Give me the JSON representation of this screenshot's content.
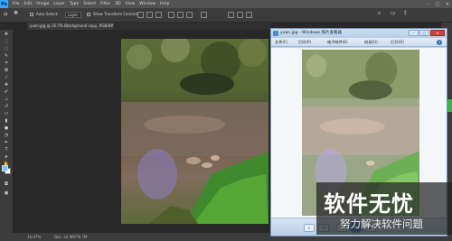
{
  "photoshop": {
    "menus": [
      "File",
      "Edit",
      "Image",
      "Layer",
      "Type",
      "Select",
      "Filter",
      "3D",
      "View",
      "Window",
      "Help"
    ],
    "options": {
      "auto_select_label": "Auto-Select:",
      "auto_select_value": "Layer",
      "transform_controls_label": "Show Transform Controls"
    },
    "document_tab": "yuan.jpg @ 16.7% (Background copy, RGB/8#) *",
    "status": {
      "zoom": "16.67%",
      "doc_size": "Doc: 24.9M/76.7M"
    },
    "colors": {
      "foreground": "#6fc6ff",
      "background": "#ffffff",
      "accent": "#31a8ff"
    }
  },
  "viewer": {
    "title": "yuan.jpg - Windows 照片查看器",
    "menu": [
      "文件(F)",
      "打印(P)",
      "电子邮件(E)",
      "刻录(U)",
      "打开(O)"
    ],
    "footer_icons": [
      "zoom-icon",
      "fit-icon",
      "previous-icon",
      "play-slideshow-icon",
      "next-icon",
      "rotate-left-icon",
      "rotate-right-icon",
      "delete-icon"
    ]
  },
  "watermark": {
    "title": "软件无忧",
    "subtitle": "努力解决软件问题"
  }
}
